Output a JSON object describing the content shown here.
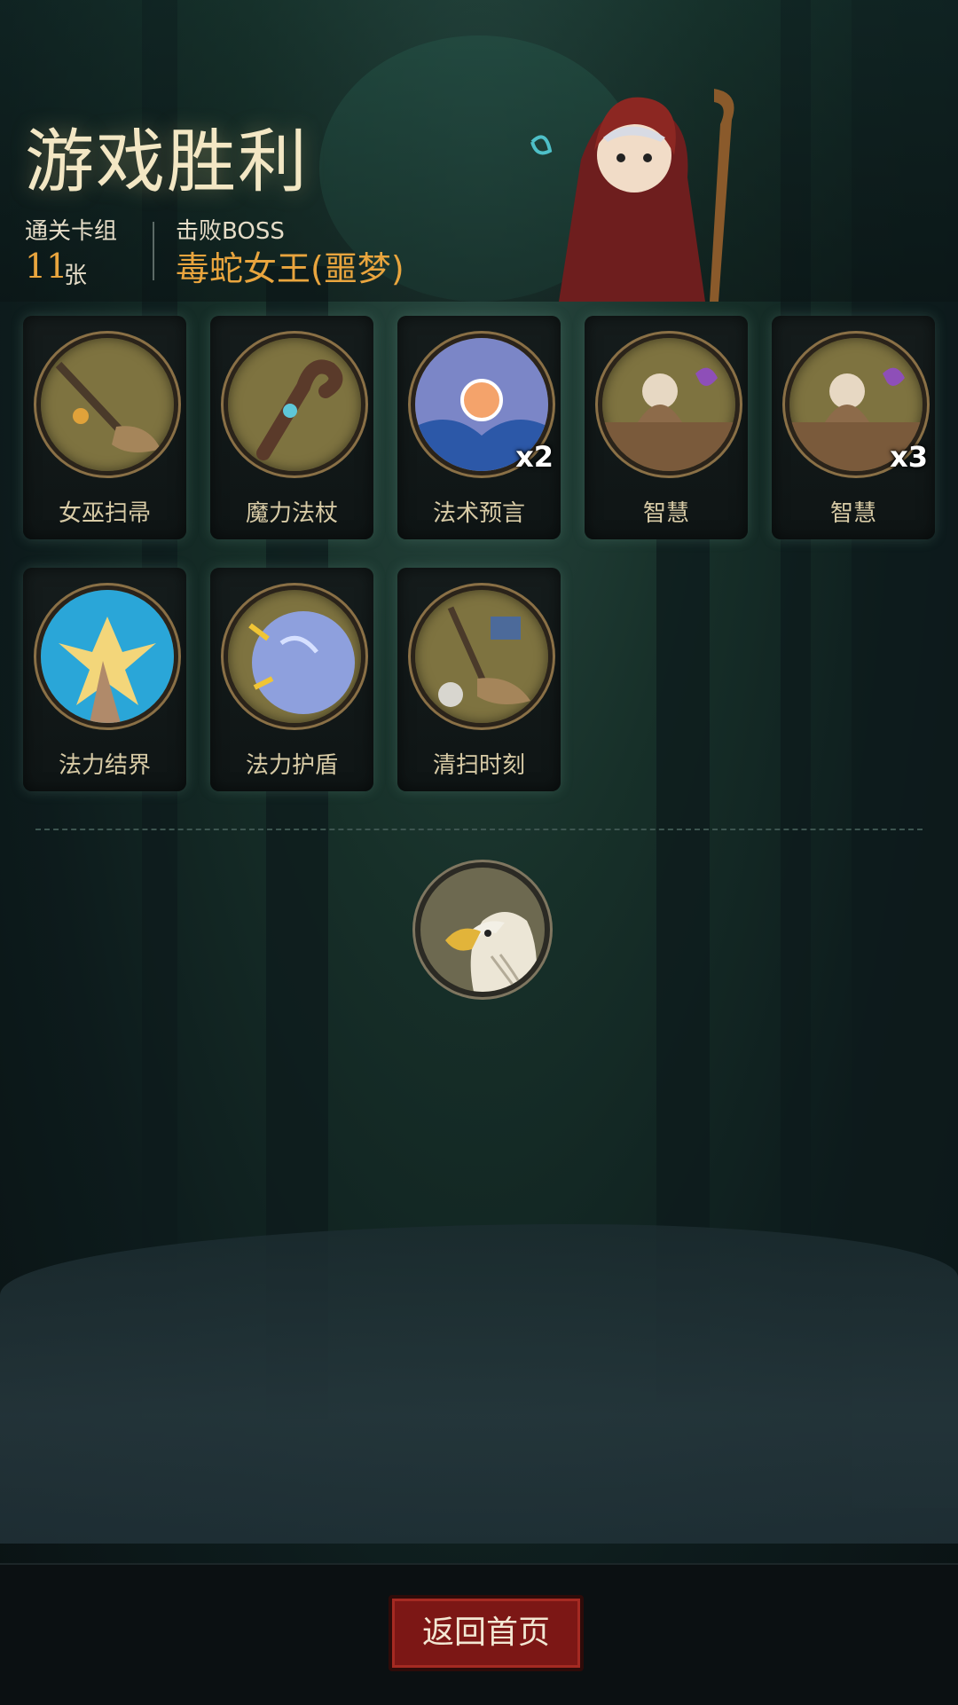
{
  "result": {
    "title": "游戏胜利",
    "deck_label": "通关卡组",
    "deck_count": "11",
    "deck_unit": "张",
    "boss_label": "击败BOSS",
    "boss_name": "毒蛇女王(噩梦)"
  },
  "cards": [
    {
      "name": "女巫扫帚",
      "icon": "witch-broom-icon",
      "count": ""
    },
    {
      "name": "魔力法杖",
      "icon": "magic-staff-icon",
      "count": ""
    },
    {
      "name": "法术预言",
      "icon": "spell-prophecy-icon",
      "count": "x2"
    },
    {
      "name": "智慧",
      "icon": "wisdom-sage-icon",
      "count": ""
    },
    {
      "name": "智慧",
      "icon": "wisdom-sage-icon",
      "count": "x3"
    },
    {
      "name": "法力结界",
      "icon": "mana-barrier-icon",
      "count": ""
    },
    {
      "name": "法力护盾",
      "icon": "mana-shield-icon",
      "count": ""
    },
    {
      "name": "清扫时刻",
      "icon": "sweep-time-icon",
      "count": ""
    }
  ],
  "relic": {
    "icon": "eagle-icon"
  },
  "footer": {
    "home_button": "返回首页"
  },
  "colors": {
    "accent_gold": "#e9a53e",
    "button_red": "#7c1715",
    "medal_olive": "#7e7340"
  }
}
